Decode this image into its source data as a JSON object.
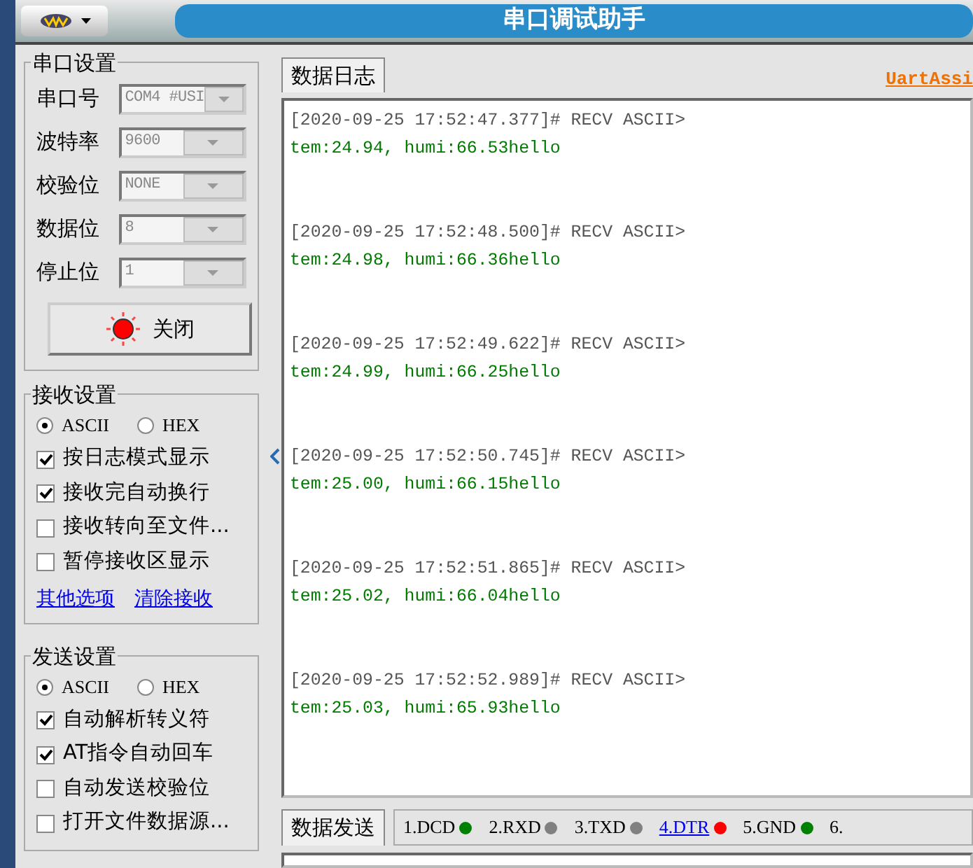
{
  "window": {
    "title": "串口调试助手"
  },
  "serial_settings": {
    "title": "串口设置",
    "fields": [
      {
        "label": "串口号",
        "value": "COM4 #USI"
      },
      {
        "label": "波特率",
        "value": "9600"
      },
      {
        "label": "校验位",
        "value": "NONE"
      },
      {
        "label": "数据位",
        "value": "8"
      },
      {
        "label": "停止位",
        "value": "1"
      }
    ],
    "open_button": {
      "label": "关闭",
      "on": true
    }
  },
  "receive_settings": {
    "title": "接收设置",
    "modes": [
      {
        "label": "ASCII",
        "selected": true
      },
      {
        "label": "HEX",
        "selected": false
      }
    ],
    "options": [
      {
        "label": "按日志模式显示",
        "checked": true
      },
      {
        "label": "接收完自动换行",
        "checked": true
      },
      {
        "label": "接收转向至文件...",
        "checked": false
      },
      {
        "label": "暂停接收区显示",
        "checked": false
      }
    ],
    "links": [
      "其他选项",
      "清除接收"
    ]
  },
  "send_settings": {
    "title": "发送设置",
    "modes": [
      {
        "label": "ASCII",
        "selected": true
      },
      {
        "label": "HEX",
        "selected": false
      }
    ],
    "options": [
      {
        "label": "自动解析转义符",
        "checked": true
      },
      {
        "label": "AT指令自动回车",
        "checked": true
      },
      {
        "label": "自动发送校验位",
        "checked": false
      },
      {
        "label": "打开文件数据源...",
        "checked": false
      }
    ]
  },
  "log_tab": {
    "label": "数据日志",
    "selected": true
  },
  "brand_link": "UartAssi",
  "log": [
    {
      "header": "[2020-09-25 17:52:47.377]# RECV ASCII>",
      "data": "tem:24.94, humi:66.53hello"
    },
    {
      "header": "[2020-09-25 17:52:48.500]# RECV ASCII>",
      "data": "tem:24.98, humi:66.36hello"
    },
    {
      "header": "[2020-09-25 17:52:49.622]# RECV ASCII>",
      "data": "tem:24.99, humi:66.25hello"
    },
    {
      "header": "[2020-09-25 17:52:50.745]# RECV ASCII>",
      "data": "tem:25.00, humi:66.15hello"
    },
    {
      "header": "[2020-09-25 17:52:51.865]# RECV ASCII>",
      "data": "tem:25.02, humi:66.04hello"
    },
    {
      "header": "[2020-09-25 17:52:52.989]# RECV ASCII>",
      "data": "tem:25.03, humi:65.93hello"
    }
  ],
  "send_tab": {
    "label": "数据发送",
    "selected": true
  },
  "signals": [
    {
      "label": "1.DCD",
      "color": "#008000",
      "kind": "plain"
    },
    {
      "label": "2.RXD",
      "color": "#808080",
      "kind": "plain"
    },
    {
      "label": "3.TXD",
      "color": "#808080",
      "kind": "plain"
    },
    {
      "label": "4.DTR",
      "color": "#ff0000",
      "kind": "link"
    },
    {
      "label": "5.GND",
      "color": "#008000",
      "kind": "plain"
    },
    {
      "label": "6.",
      "kind": "plain"
    }
  ]
}
